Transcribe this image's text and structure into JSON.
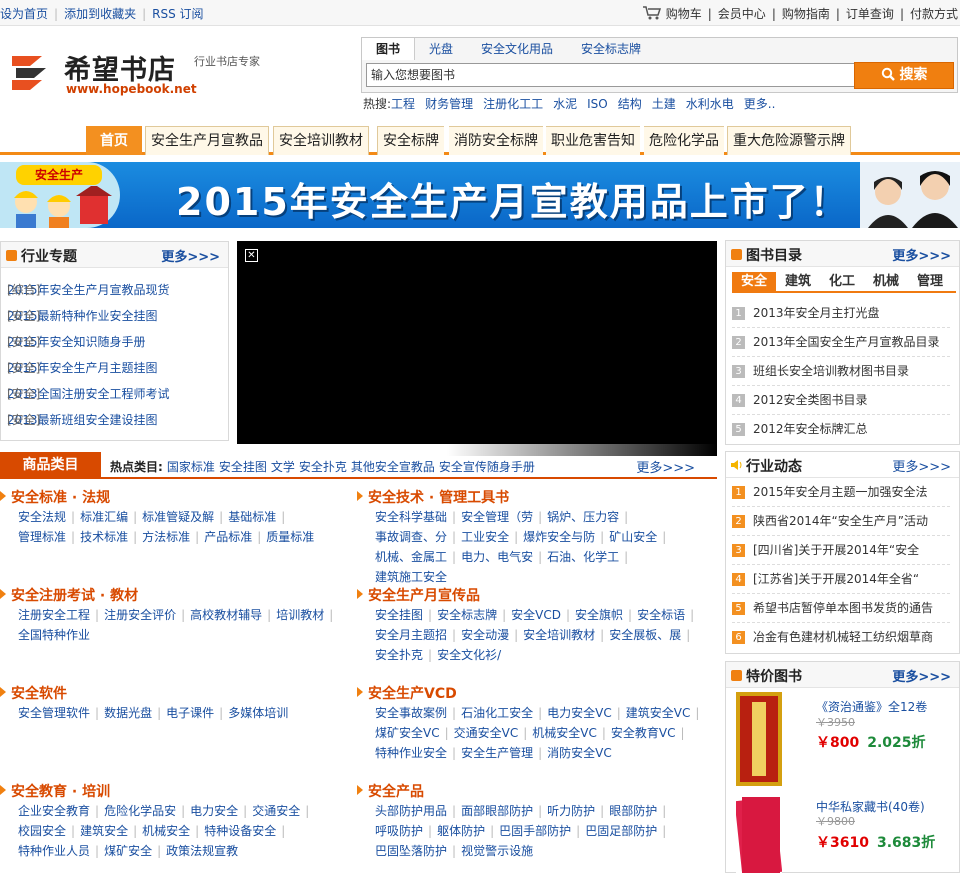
{
  "topbar": {
    "left": [
      "设为首页",
      "添加到收藏夹",
      "RSS 订阅"
    ],
    "cart": "购物车",
    "right": [
      "会员中心",
      "购物指南",
      "订单查询",
      "付款方式"
    ]
  },
  "logo": {
    "name": "希望书店",
    "url": "www.hopebook.net",
    "slogan": "行业书店专家"
  },
  "search": {
    "tabs": [
      "图书",
      "光盘",
      "安全文化用品",
      "安全标志牌"
    ],
    "placeholder": "输入您想要图书",
    "button": "搜索"
  },
  "hot_search": {
    "label": "热搜:",
    "items": [
      "工程",
      "财务管理",
      "注册化工工",
      "水泥",
      "ISO",
      "结构",
      "土建",
      "水利水电",
      "更多.."
    ]
  },
  "nav": [
    "首页",
    "安全生产月宣教品",
    "安全培训教材",
    "安全标牌",
    "消防安全标牌",
    "职业危害告知",
    "危险化学品",
    "重大危险源警示牌"
  ],
  "banner": {
    "badge": "安全生产",
    "text": "2015年安全生产月宣教用品上市了！"
  },
  "industry": {
    "title": "行业专题",
    "more": "更多>>>",
    "items": [
      {
        "cat": "[综合]",
        "title": "2015年安全生产月宣教品现货"
      },
      {
        "cat": "[安全]",
        "title": "2015最新特种作业安全挂图"
      },
      {
        "cat": "[安全]",
        "title": "2015年安全知识随身手册"
      },
      {
        "cat": "[安全]",
        "title": "2015年安全生产月主题挂图"
      },
      {
        "cat": "[安全]",
        "title": "2013全国注册安全工程师考试"
      },
      {
        "cat": "[安全]",
        "title": "2013最新班组安全建设挂图"
      }
    ]
  },
  "book_catalog": {
    "title": "图书目录",
    "more": "更多>>>",
    "tabs": [
      "安全",
      "建筑",
      "化工",
      "机械",
      "管理"
    ],
    "items": [
      "2013年安全月主打光盘",
      "2013年全国安全生产月宣教品目录",
      "班组长安全培训教材图书目录",
      "2012安全类图书目录",
      "2012年安全标牌汇总"
    ]
  },
  "news": {
    "title": "行业动态",
    "more": "更多>>>",
    "items": [
      "2015年安全月主题一加强安全法",
      "陕西省2014年“安全生产月”活动",
      "[四川省]关于开展2014年“安全",
      "[江苏省]关于开展2014年全省“",
      "希望书店暂停单本图书发货的通告",
      "冶金有色建材机械轻工纺织烟草商"
    ]
  },
  "special": {
    "title": "特价图书",
    "more": "更多>>>",
    "books": [
      {
        "title": "《资治通鉴》全12卷",
        "old": "￥3950",
        "price": "￥800",
        "discount": "2.025折"
      },
      {
        "title": "中华私家藏书(40卷)",
        "old": "￥9800",
        "price": "￥3610",
        "discount": "3.683折"
      }
    ]
  },
  "categories": {
    "title": "商品类目",
    "hot_label": "热点类目:",
    "hot": [
      "国家标准",
      "安全挂图",
      "文学",
      "安全扑克",
      "其他安全宣教品",
      "安全宣传随身手册"
    ],
    "more": "更多>>>",
    "sections": [
      {
        "title": "安全标准 · 法规",
        "links": [
          "安全法规",
          "标准汇编",
          "标准管疑及解",
          "基础标准",
          "管理标准",
          "技术标准",
          "方法标准",
          "产品标准",
          "质量标准"
        ]
      },
      {
        "title": "安全技术 · 管理工具书",
        "links": [
          "安全科学基础",
          "安全管理（劳",
          "锅炉、压力容",
          "事故调查、分",
          "工业安全",
          "爆炸安全与防",
          "矿山安全",
          "机械、金属工",
          "电力、电气安",
          "石油、化学工",
          "建筑施工安全"
        ]
      },
      {
        "title": "安全注册考试 · 教材",
        "links": [
          "注册安全工程",
          "注册安全评价",
          "高校教材辅导",
          "培训教材",
          "全国特种作业"
        ]
      },
      {
        "title": "安全生产月宣传品",
        "links": [
          "安全挂图",
          "安全标志牌",
          "安全VCD",
          "安全旗帜",
          "安全标语",
          "安全月主题招",
          "安全动漫",
          "安全培训教材",
          "安全展板、展",
          "安全扑克",
          "安全文化衫/"
        ]
      },
      {
        "title": "安全软件",
        "links": [
          "安全管理软件",
          "数据光盘",
          "电子课件",
          "多媒体培训"
        ]
      },
      {
        "title": "安全生产VCD",
        "links": [
          "安全事故案例",
          "石油化工安全",
          "电力安全VC",
          "建筑安全VC",
          "煤矿安全VC",
          "交通安全VC",
          "机械安全VC",
          "安全教育VC",
          "特种作业安全",
          "安全生产管理",
          "消防安全VC"
        ]
      },
      {
        "title": "安全教育 · 培训",
        "links": [
          "企业安全教育",
          "危险化学品安",
          "电力安全",
          "交通安全",
          "校园安全",
          "建筑安全",
          "机械安全",
          "特种设备安全",
          "特种作业人员",
          "煤矿安全",
          "政策法规宣教"
        ]
      },
      {
        "title": "安全产品",
        "links": [
          "头部防护用品",
          "面部眼部防护",
          "听力防护",
          "眼部防护",
          "呼吸防护",
          "躯体防护",
          "巴固手部防护",
          "巴固足部防护",
          "巴固坠落防护",
          "视觉警示设施"
        ]
      }
    ]
  }
}
